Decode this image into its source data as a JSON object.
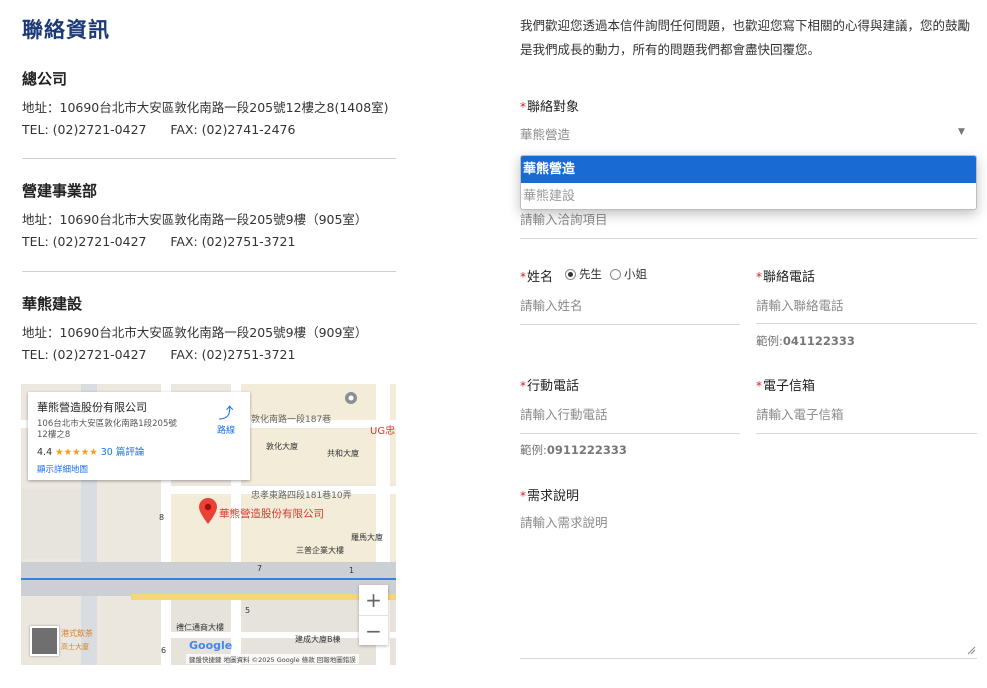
{
  "contact": {
    "title": "聯絡資訊",
    "offices": [
      {
        "name": "總公司",
        "address": "地址：10690台北市大安區敦化南路一段205號12樓之8(1408室)",
        "tel": "TEL: (02)2721-0427",
        "fax": "FAX: (02)2741-2476"
      },
      {
        "name": "營建事業部",
        "address": "地址：10690台北市大安區敦化南路一段205號9樓（905室）",
        "tel": "TEL: (02)2721-0427",
        "fax": "FAX: (02)2751-3721"
      },
      {
        "name": "華熊建設",
        "address": "地址：10690台北市大安區敦化南路一段205號9樓（909室）",
        "tel": "TEL: (02)2721-0427",
        "fax": "FAX: (02)2751-3721"
      }
    ]
  },
  "map": {
    "card": {
      "name": "華熊營造股份有限公司",
      "address": "106台北市大安區敦化南路1段205號12樓之8",
      "rating": "4.4",
      "stars": "★★★★★",
      "reviews": "30 篇評論",
      "more": "顯示詳細地圖",
      "route": "路線"
    },
    "pin_label": "華熊營造股份有限公司",
    "labels": {
      "road1": "敦化南路一段187巷",
      "road2": "忠孝東路四段181巷10弄",
      "bldg1": "敦化大廈",
      "bldg2": "共和大廈",
      "bldg3": "三普企業大樓",
      "bldg4": "羅馬大廈",
      "bldg5": "禮仁通商大樓",
      "bldg6": "建成大廈B棟",
      "ug": "UG忠",
      "num8": "8",
      "num7": "7",
      "num1": "1",
      "num5": "5",
      "num6": "6",
      "tea": "港式飲茶",
      "gaoshi": "高士大廈",
      "google": "Google",
      "attribution": "鍵盤快捷鍵  地圖資料 ©2025 Google  條款  回報地圖錯誤"
    },
    "zoom_in": "+",
    "zoom_out": "−"
  },
  "form": {
    "intro": "我們歡迎您透過本信件詢問任何問題，也歡迎您寫下相關的心得與建議，您的鼓勵是我們成長的動力，所有的問題我們都會盡快回覆您。",
    "required_mark": "*",
    "contact_target": {
      "label": "聯絡對象",
      "value": "華熊營造"
    },
    "dropdown_options": [
      "華熊營造",
      "華熊建設"
    ],
    "inquiry_placeholder": "請輸入洽詢項目",
    "name": {
      "label": "姓名",
      "placeholder": "請輸入姓名",
      "options": [
        "先生",
        "小姐"
      ],
      "selected": "先生"
    },
    "phone": {
      "label": "聯絡電話",
      "placeholder": "請輸入聯絡電話",
      "hint_label": "範例:",
      "hint_value": "041122333"
    },
    "mobile": {
      "label": "行動電話",
      "placeholder": "請輸入行動電話",
      "hint_label": "範例:",
      "hint_value": "0911222333"
    },
    "email": {
      "label": "電子信箱",
      "placeholder": "請輸入電子信箱"
    },
    "needs": {
      "label": "需求說明",
      "placeholder": "請輸入需求說明"
    }
  }
}
